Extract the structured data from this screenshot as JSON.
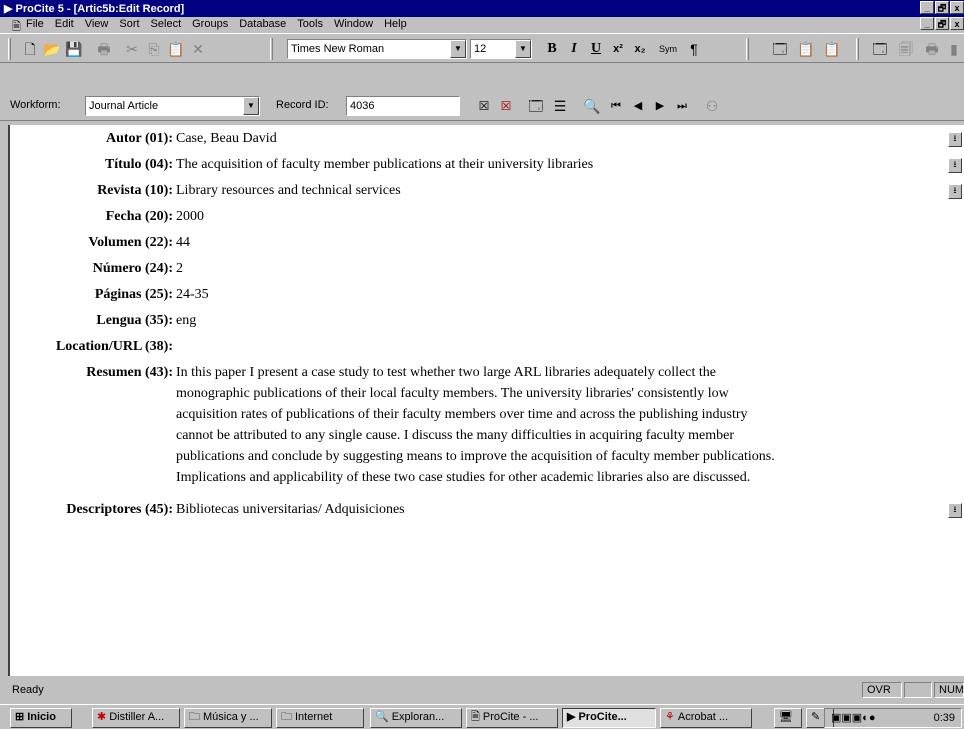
{
  "window": {
    "title": "ProCite 5 - [Artic5b:Edit Record]",
    "minimize": "_",
    "maximize": "🗗",
    "close": "x"
  },
  "menu": {
    "items": [
      "File",
      "Edit",
      "View",
      "Sort",
      "Select",
      "Groups",
      "Database",
      "Tools",
      "Window",
      "Help"
    ]
  },
  "toolbar": {
    "font_name": "Times New Roman",
    "font_size": "12",
    "bold": "B",
    "italic": "I",
    "underline": "U",
    "superscript": "x²",
    "subscript": "x₂",
    "symbol": "Sym",
    "paragraph": "¶"
  },
  "workform": {
    "label": "Workform:",
    "value": "Journal Article",
    "record_id_label": "Record ID:",
    "record_id": "4036"
  },
  "record": {
    "fields": [
      {
        "name": "Autor (01):",
        "value": "Case, Beau David"
      },
      {
        "name": "Título (04):",
        "value": "The acquisition of faculty member publications at their university libraries"
      },
      {
        "name": "Revista (10):",
        "value": "Library resources and technical services"
      },
      {
        "name": "Fecha (20):",
        "value": "2000"
      },
      {
        "name": "Volumen (22):",
        "value": "44"
      },
      {
        "name": "Número (24):",
        "value": "2"
      },
      {
        "name": "Páginas (25):",
        "value": "24-35"
      },
      {
        "name": "Lengua (35):",
        "value": "eng"
      },
      {
        "name": "Location/URL (38):",
        "value": ""
      }
    ],
    "abstract": {
      "name": "Resumen (43):",
      "lines": [
        "In this paper I present a case study to test whether two large ARL libraries adequately collect the",
        "monographic publications of their local faculty members. The university libraries' consistently low",
        "acquisition rates of publications of their faculty members over time and across the publishing industry",
        "cannot be attributed to any single cause. I discuss the many difficulties in acquiring faculty member",
        "publications and conclude by suggesting means to improve the acquisition of faculty member publications.",
        "Implications and applicability of these two case studies for other academic libraries also are discussed."
      ]
    },
    "descriptors": {
      "name": "Descriptores (45):",
      "value": "Bibliotecas universitarias/ Adquisiciones"
    }
  },
  "status": {
    "text": "Ready",
    "ovr": "OVR",
    "num": "NUM"
  },
  "taskbar": {
    "start": "Inicio",
    "tasks": [
      "Distiller A...",
      "Música y ...",
      "Internet",
      "Exploran...",
      "ProCite - ...",
      "ProCite...",
      "Acrobat ..."
    ],
    "clock": "0:39"
  }
}
